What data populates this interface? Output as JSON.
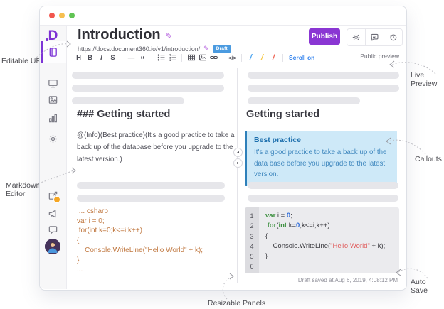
{
  "colors": {
    "accent_purple": "#8a36d3",
    "draft_badge_blue": "#4b9be0",
    "link_blue": "#2f80ed",
    "callout_bg": "#cee9f8",
    "callout_border": "#2e80ba",
    "editor_code_orange": "#c0773f",
    "code_green": "#3f9142",
    "code_blue": "#2d6bd8",
    "code_red": "#e05c5c",
    "traffic_lights": [
      "#f2564e",
      "#f6bf50",
      "#61c454"
    ],
    "pen_colors": [
      "#4aa3f0",
      "#f7c948",
      "#ee6352"
    ]
  },
  "sidebar": {
    "icons": [
      "documentation",
      "desktop",
      "media",
      "analytics",
      "settings"
    ],
    "bottom_icons": [
      "external-link",
      "announcement",
      "feedback",
      "avatar"
    ]
  },
  "header": {
    "title": "Introduction",
    "url": "https://docs.document360.io/v1/introduction/",
    "draft_badge": "Draft",
    "publish_label": "Publish",
    "icons": [
      "settings",
      "comments",
      "history"
    ]
  },
  "toolbar": {
    "glyphs": {
      "heading": "H",
      "bold": "B",
      "italic": "I",
      "strikethrough": "S",
      "horizontal_rule": "—",
      "blockquote": "“",
      "code": "</>"
    },
    "scroll_on": "Scroll on",
    "public_preview": "Public preview"
  },
  "editor": {
    "heading": "### Getting started",
    "paragraph": "@(Info)(Best practice)(It's a good practice to take a back up of the database before you upgrade to the latest version.)",
    "code_lines": [
      " ... csharp",
      "var i = 0;",
      " for(int k=0;k<=i;k++)",
      "{",
      "    Console.WriteLine(\"Hello World\" + k);",
      "}",
      "..."
    ]
  },
  "preview": {
    "heading": "Getting started",
    "callout": {
      "title": "Best practice",
      "body": "It's a good practice to take a back up of the data base before you upgrade to the latest version."
    },
    "code": {
      "lines": [
        {
          "num": "1",
          "segments": [
            {
              "t": "var",
              "c": "g"
            },
            {
              "t": " i = ",
              "c": "p"
            },
            {
              "t": "0",
              "c": "b"
            },
            {
              "t": ";",
              "c": "p"
            }
          ]
        },
        {
          "num": "2",
          "segments": [
            {
              "t": " ",
              "c": "p"
            },
            {
              "t": "for",
              "c": "g"
            },
            {
              "t": "(",
              "c": "p"
            },
            {
              "t": "int",
              "c": "g"
            },
            {
              "t": " k=",
              "c": "p"
            },
            {
              "t": "0",
              "c": "b"
            },
            {
              "t": ";k<=i;k++)",
              "c": "p"
            }
          ]
        },
        {
          "num": "3",
          "segments": [
            {
              "t": "{",
              "c": "p"
            }
          ]
        },
        {
          "num": "4",
          "segments": [
            {
              "t": "    Console.WriteLine(",
              "c": "p"
            },
            {
              "t": "\"Hello World\"",
              "c": "r"
            },
            {
              "t": " + k);",
              "c": "p"
            }
          ]
        },
        {
          "num": "5",
          "segments": [
            {
              "t": "}",
              "c": "p"
            }
          ]
        },
        {
          "num": "6",
          "segments": []
        }
      ]
    },
    "autosave": "Draft saved at Aug 6, 2019, 4:08:12 PM"
  },
  "annotations": {
    "editable_url": "Editable URL",
    "live_preview": "Live Preview",
    "markdown_editor": "Markdown Editor",
    "callouts": "Callouts",
    "resizable_panels": "Resizable Panels",
    "auto_save": "Auto Save"
  }
}
